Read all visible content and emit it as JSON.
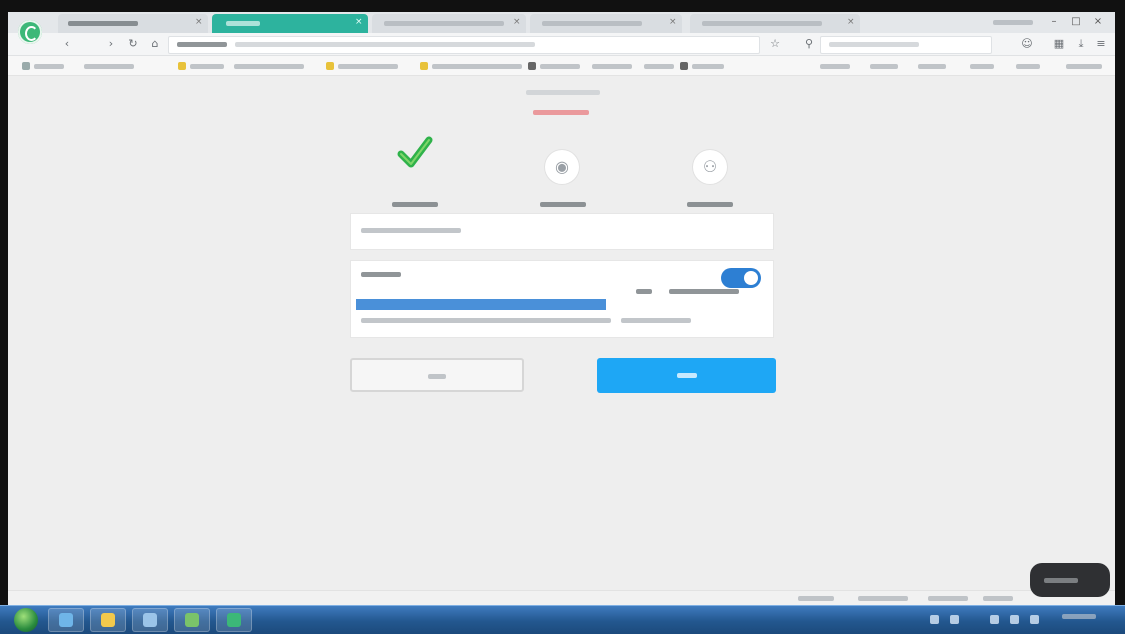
{
  "colors": {
    "accent": "#2db39e",
    "primary": "#1ea7f5",
    "success": "#2fb24a",
    "toggle": "#2d7fd3",
    "selection": "#4a90d9",
    "notice": "#e8545a"
  },
  "browser": {
    "logo_icon": "browser-logo-icon",
    "tabs": [
      {
        "active": false
      },
      {
        "active": true
      },
      {
        "active": false
      },
      {
        "active": false
      },
      {
        "active": false
      }
    ]
  },
  "wizard": {
    "steps": [
      {
        "icon": "check-icon",
        "completed": true
      },
      {
        "icon": "step-circle-icon",
        "completed": false
      },
      {
        "icon": "step-circle-icon",
        "completed": false
      }
    ],
    "toggle_on": true
  },
  "taskbar": {
    "start_icon": "windows-start-icon"
  }
}
